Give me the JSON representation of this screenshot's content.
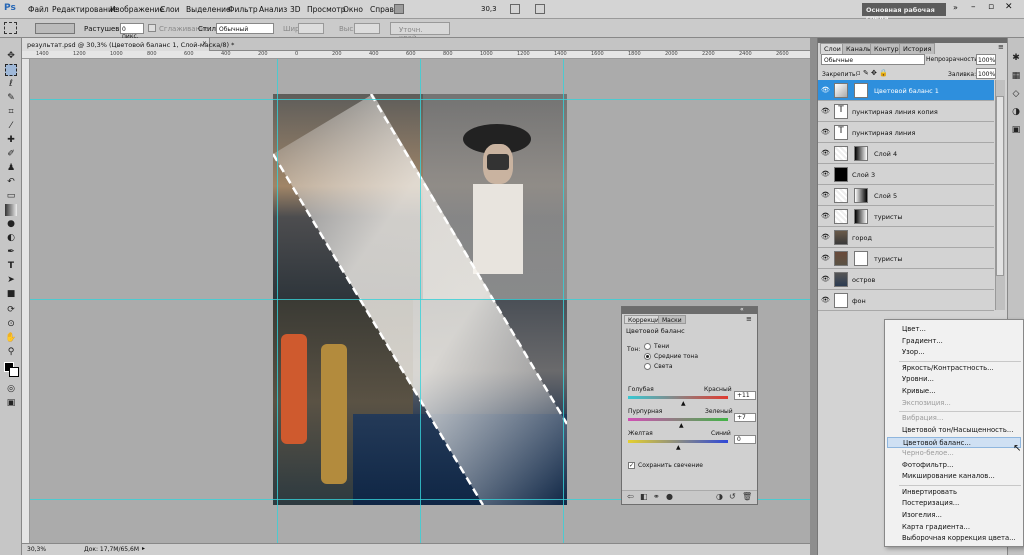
{
  "app": {
    "logo": "Ps",
    "workspace_button": "Основная рабочая среда",
    "zoom": "30,3"
  },
  "menu": [
    "Файл",
    "Редактирование",
    "Изображение",
    "Слои",
    "Выделение",
    "Фильтр",
    "Анализ",
    "3D",
    "Просмотр",
    "Окно",
    "Справка"
  ],
  "options": {
    "feather_label": "Растушевка:",
    "feather_value": "0 пикс.",
    "antialias_label": "Сглаживание",
    "style_label": "Стиль:",
    "style_value": "Обычный",
    "width_label": "Шир.:",
    "height_label": "Выс.:",
    "refine_button": "Уточн. край..."
  },
  "document": {
    "tab_title": "результат.psd @ 30,3% (Цветовой баланс 1, Слой-маска/8) *",
    "status_zoom": "30,3%",
    "status_doc": "Док: 17,7M/65,6M"
  },
  "ruler_ticks": [
    "1400",
    "1200",
    "1000",
    "800",
    "600",
    "400",
    "200",
    "0",
    "200",
    "400",
    "600",
    "800",
    "1000",
    "1200",
    "1400",
    "1600",
    "1800",
    "2000",
    "2200",
    "2400",
    "2600"
  ],
  "layers_panel": {
    "tabs": [
      "Слои",
      "Каналы",
      "Контуры",
      "История"
    ],
    "blend_mode": "Обычные",
    "opacity_label": "Непрозрачность:",
    "opacity_value": "100%",
    "lock_label": "Закрепить:",
    "fill_label": "Заливка:",
    "fill_value": "100%",
    "layers": [
      {
        "name": "Цветовой баланс 1",
        "selected": true
      },
      {
        "name": "пунктирная линия копия",
        "selected": false
      },
      {
        "name": "пунктирная линия",
        "selected": false
      },
      {
        "name": "Слой 4",
        "selected": false
      },
      {
        "name": "Слой 3",
        "selected": false
      },
      {
        "name": "Слой 5",
        "selected": false
      },
      {
        "name": "туристы",
        "selected": false
      },
      {
        "name": "город",
        "selected": false
      },
      {
        "name": "туристы",
        "selected": false
      },
      {
        "name": "остров",
        "selected": false
      },
      {
        "name": "фон",
        "selected": false
      }
    ]
  },
  "adjustments": {
    "tabs": [
      "Коррекция",
      "Маски"
    ],
    "title": "Цветовой баланс",
    "tone_label": "Тон:",
    "tones": [
      "Тени",
      "Средние тона",
      "Света"
    ],
    "selected_tone": "Средние тона",
    "sliders": [
      {
        "left": "Голубая",
        "right": "Красный",
        "value": "+11",
        "position": 0.55
      },
      {
        "left": "Пурпурная",
        "right": "Зеленый",
        "value": "+7",
        "position": 0.53
      },
      {
        "left": "Желтая",
        "right": "Синий",
        "value": "0",
        "position": 0.5
      }
    ],
    "preserve_label": "Сохранить свечение",
    "preserve_checked": true
  },
  "context_menu": {
    "items": [
      {
        "label": "Цвет...",
        "disabled": false
      },
      {
        "label": "Градиент...",
        "disabled": false
      },
      {
        "label": "Узор...",
        "disabled": false
      },
      {
        "sep": true
      },
      {
        "label": "Яркость/Контрастность...",
        "disabled": false
      },
      {
        "label": "Уровни...",
        "disabled": false
      },
      {
        "label": "Кривые...",
        "disabled": false
      },
      {
        "label": "Экспозиция...",
        "disabled": true
      },
      {
        "sep": true
      },
      {
        "label": "Вибрация...",
        "disabled": true
      },
      {
        "label": "Цветовой тон/Насыщенность...",
        "disabled": false
      },
      {
        "label": "Цветовой баланс...",
        "disabled": false,
        "highlighted": true
      },
      {
        "label": "Черно-белое...",
        "disabled": true
      },
      {
        "label": "Фотофильтр...",
        "disabled": false
      },
      {
        "label": "Микширование каналов...",
        "disabled": false
      },
      {
        "sep": true
      },
      {
        "label": "Инвертировать",
        "disabled": false
      },
      {
        "label": "Постеризация...",
        "disabled": false
      },
      {
        "label": "Изогелия...",
        "disabled": false
      },
      {
        "label": "Карта градиента...",
        "disabled": false
      },
      {
        "label": "Выборочная коррекция цвета...",
        "disabled": false
      }
    ]
  },
  "colors": {
    "accent": "#2e8fdd",
    "guide": "#36d2d9",
    "highlight": "#cfe0f3"
  }
}
